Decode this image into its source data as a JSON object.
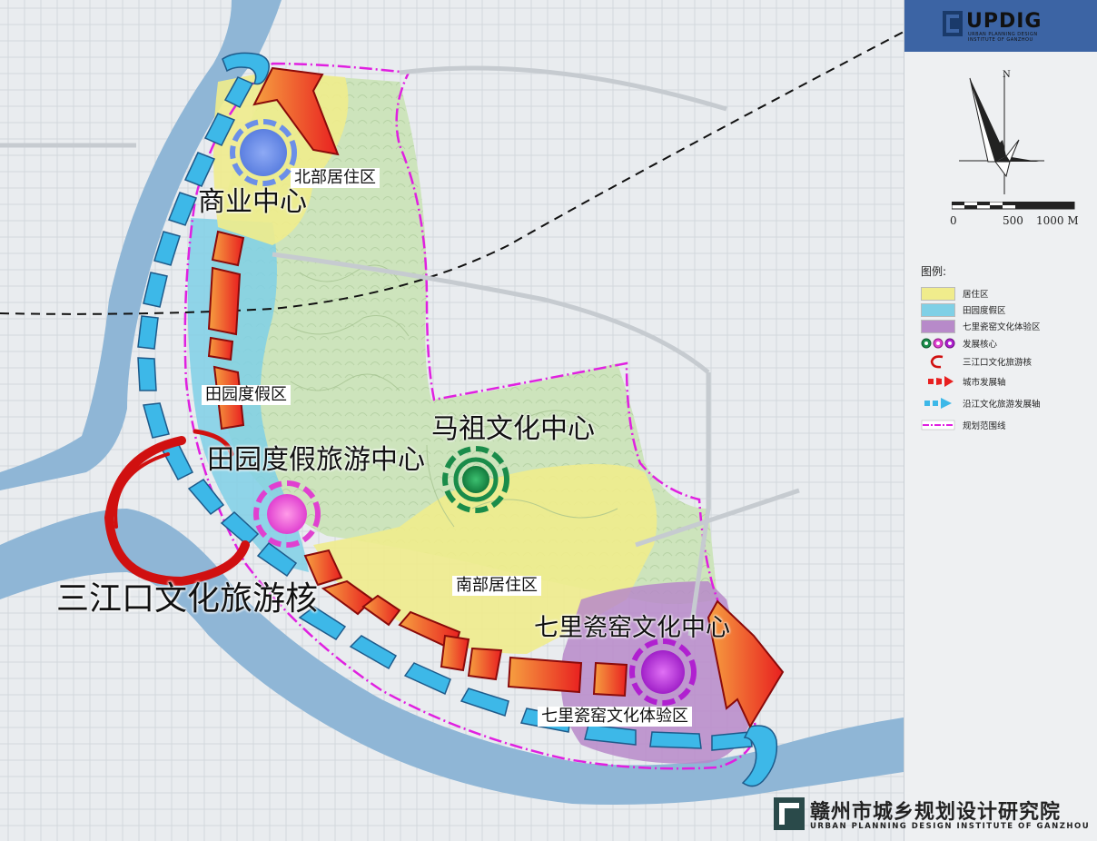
{
  "map": {
    "labels": {
      "commerce_center": "商业中心",
      "north_residential": "北部居住区",
      "farm_resort_zone": "田园度假区",
      "farm_resort_center": "田园度假旅游中心",
      "mazu_center": "马祖文化中心",
      "south_residential": "南部居住区",
      "three_rivers_core": "三江口文化旅游核",
      "qili_center": "七里瓷窑文化中心",
      "qili_zone": "七里瓷窑文化体验区"
    },
    "colors": {
      "river": "#8fb6d6",
      "residential": "#f0ec8c",
      "resort": "#7fd0e6",
      "kiln": "#b78ac9",
      "green": "#cfe6bd",
      "boundary": "#e020e0",
      "axis_red": "#e82020",
      "axis_orange": "#f07030",
      "river_axis": "#3db8e8",
      "core_commerce": "#6b8fe8",
      "core_mazu": "#1a8c4a",
      "core_resort": "#e040d0",
      "core_kiln": "#b020d0",
      "three_rivers_ring": "#d01010"
    }
  },
  "panel": {
    "logo": {
      "name": "UPDIG",
      "sub1": "URBAN PLANNING DESIGN",
      "sub2": "INSTITUTE OF GANZHOU"
    },
    "north_label": "N",
    "scale": {
      "t0": "0",
      "t1": "500",
      "t2": "1000 M"
    },
    "legend": {
      "title": "图例:",
      "items": [
        {
          "label": "居住区",
          "icon": "residential-swatch"
        },
        {
          "label": "田园度假区",
          "icon": "resort-swatch"
        },
        {
          "label": "七里瓷窑文化体验区",
          "icon": "kiln-swatch"
        },
        {
          "label": "发展核心",
          "icon": "core-circles"
        },
        {
          "label": "三江口文化旅游核",
          "icon": "red-ring"
        },
        {
          "label": "城市发展轴",
          "icon": "red-arrow"
        },
        {
          "label": "沿江文化旅游发展轴",
          "icon": "cyan-arrow"
        },
        {
          "label": "规划范围线",
          "icon": "boundary-line"
        }
      ]
    }
  },
  "footer": {
    "cn": "赣州市城乡规划设计研究院",
    "en": "URBAN PLANNING DESIGN INSTITUTE OF GANZHOU"
  }
}
